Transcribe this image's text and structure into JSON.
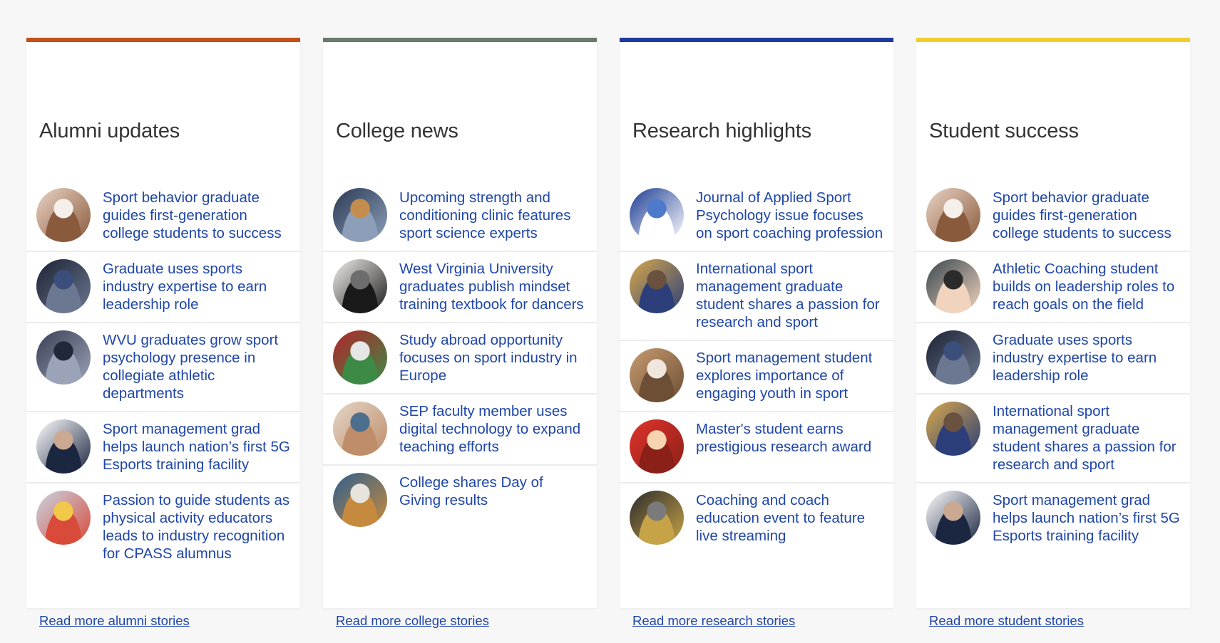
{
  "columns": [
    {
      "title": "Alumni updates",
      "accent": "#c4511a",
      "items": [
        {
          "text": "Sport behavior graduate guides first-generation college students to success",
          "icon": "woman-portrait-icon",
          "colors": [
            "#e8d3c4",
            "#8a5a3c",
            "#f4efea"
          ]
        },
        {
          "text": "Graduate uses sports industry expertise to earn leadership role",
          "icon": "jersey-presentation-photo-icon",
          "colors": [
            "#1c2233",
            "#6c7891",
            "#3b4f7a"
          ]
        },
        {
          "text": "WVU graduates grow sport psychology presence in collegiate athletic departments",
          "icon": "classroom-photo-icon",
          "colors": [
            "#3a3f55",
            "#9aa3b8",
            "#22283a"
          ]
        },
        {
          "text": "Sport management grad helps launch nation’s first 5G Esports training facility",
          "icon": "man-portrait-icon",
          "colors": [
            "#ffffff",
            "#1b2640",
            "#caa891"
          ]
        },
        {
          "text": "Passion to guide students as physical activity educators leads to industry recognition for CPASS alumnus",
          "icon": "gym-class-photo-icon",
          "colors": [
            "#c9d6e3",
            "#d84a3a",
            "#f2c84b"
          ]
        }
      ],
      "more": "Read more alumni stories"
    },
    {
      "title": "College news",
      "accent": "#6a7a6a",
      "items": [
        {
          "text": "Upcoming strength and conditioning clinic features sport science experts",
          "icon": "clinic-group-photo-icon",
          "colors": [
            "#2b3a55",
            "#8d9fb8",
            "#c58d4d"
          ]
        },
        {
          "text": "West Virginia University graduates publish mindset training textbook for dancers",
          "icon": "textbook-photo-icon",
          "colors": [
            "#f2f0ee",
            "#1a1a1a",
            "#6d6d6d"
          ]
        },
        {
          "text": "Study abroad opportunity focuses on sport industry in Europe",
          "icon": "stadium-photo-icon",
          "colors": [
            "#b2242b",
            "#3d8a46",
            "#e6e6e6"
          ]
        },
        {
          "text": "SEP faculty member uses digital technology to expand teaching efforts",
          "icon": "man-portrait-icon",
          "colors": [
            "#e2d6c7",
            "#c08d6a",
            "#4c6f8e"
          ]
        },
        {
          "text": "College shares Day of Giving results",
          "icon": "meeting-photo-icon",
          "colors": [
            "#2f5f8d",
            "#c68a3e",
            "#e7e3dd"
          ]
        }
      ],
      "more": "Read more college stories"
    },
    {
      "title": "Research highlights",
      "accent": "#1f3b9c",
      "items": [
        {
          "text": "Journal of Applied Sport Psychology issue focuses on sport coaching profession",
          "icon": "journal-logo-icon",
          "colors": [
            "#1d3d94",
            "#ffffff",
            "#4d7acb"
          ]
        },
        {
          "text": "International sport management graduate student shares a passion for research and sport",
          "icon": "arena-portrait-icon",
          "colors": [
            "#d7a84a",
            "#2c3f7a",
            "#6a5140"
          ]
        },
        {
          "text": "Sport management student explores importance of engaging youth in sport",
          "icon": "woman-portrait-icon",
          "colors": [
            "#c79b6e",
            "#6d4f36",
            "#efe7dd"
          ]
        },
        {
          "text": "Master's student earns prestigious research award",
          "icon": "smiling-man-portrait-icon",
          "colors": [
            "#e0332b",
            "#8a2017",
            "#f6d4b0"
          ]
        },
        {
          "text": "Coaching and coach education event to feature live streaming",
          "icon": "weight-room-photo-icon",
          "colors": [
            "#2c2c2c",
            "#c6a347",
            "#7a7a7a"
          ]
        }
      ],
      "more": "Read more research stories"
    },
    {
      "title": "Student success",
      "accent": "#f2cd2f",
      "items": [
        {
          "text": "Sport behavior graduate guides first-generation college students to success",
          "icon": "woman-portrait-icon",
          "colors": [
            "#e8d3c4",
            "#8a5a3c",
            "#f4efea"
          ]
        },
        {
          "text": "Athletic Coaching student builds on leadership roles to reach goals on the field",
          "icon": "young-man-portrait-icon",
          "colors": [
            "#3a4750",
            "#f0d4bd",
            "#2b2b2b"
          ]
        },
        {
          "text": "Graduate uses sports industry expertise to earn leadership role",
          "icon": "jersey-presentation-photo-icon",
          "colors": [
            "#1c2233",
            "#6c7891",
            "#3b4f7a"
          ]
        },
        {
          "text": "International sport management graduate student shares a passion for research and sport",
          "icon": "arena-portrait-icon",
          "colors": [
            "#d7a84a",
            "#2c3f7a",
            "#6a5140"
          ]
        },
        {
          "text": "Sport management grad helps launch nation’s first 5G Esports training facility",
          "icon": "man-portrait-icon",
          "colors": [
            "#ffffff",
            "#1b2640",
            "#caa891"
          ]
        }
      ],
      "more": "Read more student stories"
    }
  ]
}
